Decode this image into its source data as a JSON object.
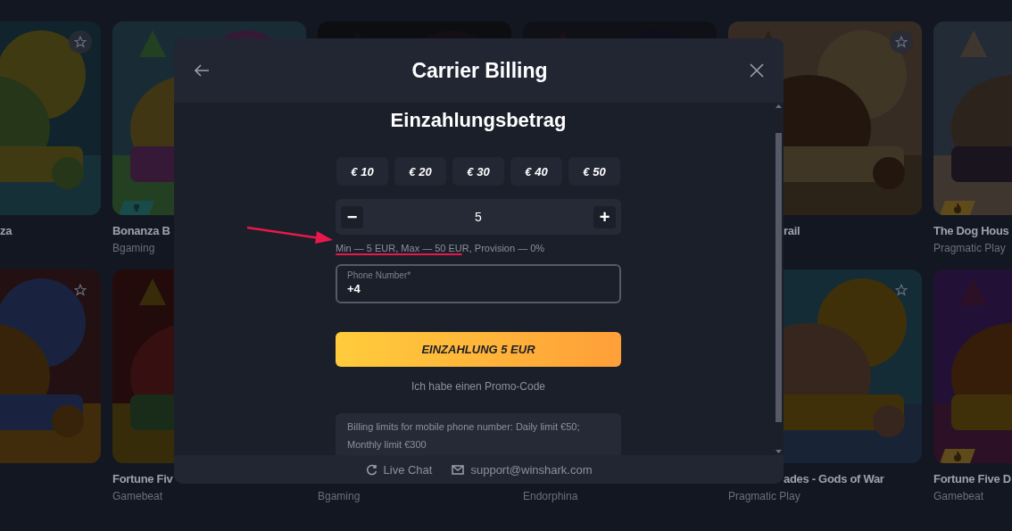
{
  "game_rows": [
    {
      "cards": [
        {
          "title": "za",
          "cut": true,
          "star": true
        },
        {
          "title": "Bonanza B",
          "provider": "Bgaming",
          "badge": {
            "kind": "trophy",
            "color": "#184b4a"
          }
        },
        {
          "kind": "covered"
        },
        {
          "kind": "covered"
        },
        {
          "title": "rail",
          "cut": true,
          "star": true
        },
        {
          "title": "The Dog Hous",
          "provider": "Pragmatic Play",
          "badge": {
            "kind": "flame",
            "color": "#5e4a1a"
          }
        }
      ]
    },
    {
      "cards": [
        {
          "star": true
        },
        {
          "title": "Fortune Fiv",
          "provider": "Gamebeat"
        },
        {
          "provider": "Bgaming"
        },
        {
          "provider": "Endorphina"
        },
        {
          "title": "ades - Gods of War",
          "cut": true,
          "provider": "Pragmatic Play",
          "star": true
        },
        {
          "title": "Fortune Five D",
          "provider": "Gamebeat",
          "badge": {
            "kind": "flame",
            "color": "#5e4a1a"
          }
        }
      ]
    }
  ],
  "modal": {
    "title": "Carrier Billing",
    "heading": "Einzahlungsbetrag",
    "amounts": [
      "€ 10",
      "€ 20",
      "€ 30",
      "€ 40",
      "€ 50"
    ],
    "stepper": {
      "minus": "−",
      "value": "5",
      "plus": "+"
    },
    "limits_hint": "Min — 5 EUR, Max — 50 EUR, Provision — 0%",
    "phone": {
      "label": "Phone Number*",
      "value": "+4"
    },
    "deposit_button": "EINZAHLUNG 5 EUR",
    "promo_link": "Ich habe einen Promo-Code",
    "info": "Billing limits for mobile phone number: Daily limit €50; Monthly limit €300",
    "footer": {
      "chat": "Live Chat",
      "email": "support@winshark.com"
    }
  }
}
